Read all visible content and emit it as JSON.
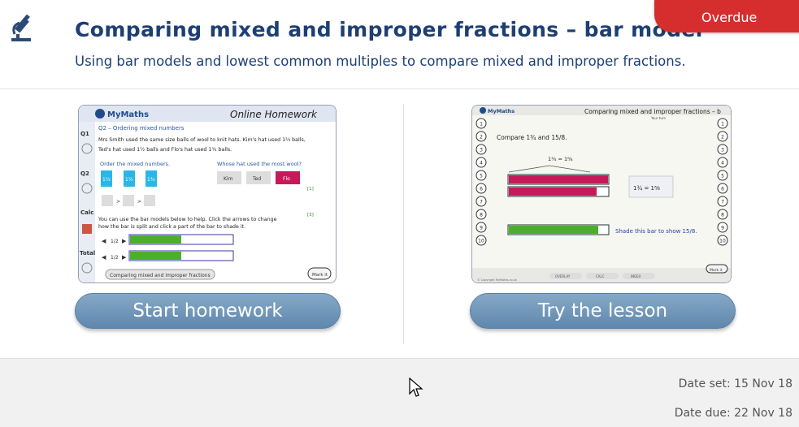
{
  "header": {
    "title": "Comparing mixed and improper fractions – bar model",
    "subtitle": "Using bar models and lowest common multiples to compare mixed and improper fractions.",
    "badge": "Overdue",
    "icon": "microscope-icon"
  },
  "homework": {
    "button_label": "Start homework",
    "thumb": {
      "brand": "MyMaths",
      "heading": "Online Homework",
      "question": "Q2 – Ordering mixed numbers",
      "body_line1": "Mrs Smith used the same size balls of wool to knit hats. Kim's hat used 1⅔ balls,",
      "body_line2": "Ted's hat used 1½ balls and Flo's hat used 1¾ balls.",
      "order_prompt": "Order the mixed numbers.",
      "whose_prompt": "Whose hat used the most wool?",
      "names": [
        "Kim",
        "Ted",
        "Flo"
      ],
      "tile_values": [
        "1⅔",
        "1½",
        "1¾"
      ],
      "side_labels": [
        "Q1",
        "Q2",
        "Calc",
        "Total"
      ],
      "mark_1": "[1]",
      "mark_2": "[3]",
      "help_line1": "You can use the bar models below to help. Click the arrows to change",
      "help_line2": "how the bar is split and click a part of the bar to shade it.",
      "bar_fracs": [
        "1/2",
        "1/2"
      ],
      "footer_tab": "Comparing mixed and improper fractions",
      "markit": "Mark it"
    }
  },
  "lesson": {
    "button_label": "Try the lesson",
    "thumb": {
      "brand": "MyMaths",
      "heading": "Comparing mixed and improper fractions – b",
      "your_turn": "Your turn",
      "prompt": "Compare 1¾ and 15/8.",
      "equation": "1¾ = 1⁶⁄₈",
      "shade_text": "Shade this bar to show 15/8.",
      "numbers": [
        "1",
        "2",
        "3",
        "4",
        "5",
        "6",
        "7",
        "8",
        "9",
        "10"
      ],
      "tabs": [
        "OVERLAY",
        "CALC",
        "INDEX"
      ],
      "markit": "Mark it",
      "copyright": "© Copyright MyMaths.co.uk"
    }
  },
  "footer": {
    "date_set": "Date set: 15 Nov 18",
    "date_due": "Date due: 22 Nov 18"
  },
  "colors": {
    "title": "#1d3f73",
    "badge": "#d62e2e",
    "button": "#6b92b7",
    "green_bar": "#4caf2a",
    "magenta": "#c8185a",
    "cyan_tile": "#2ab7e8"
  }
}
